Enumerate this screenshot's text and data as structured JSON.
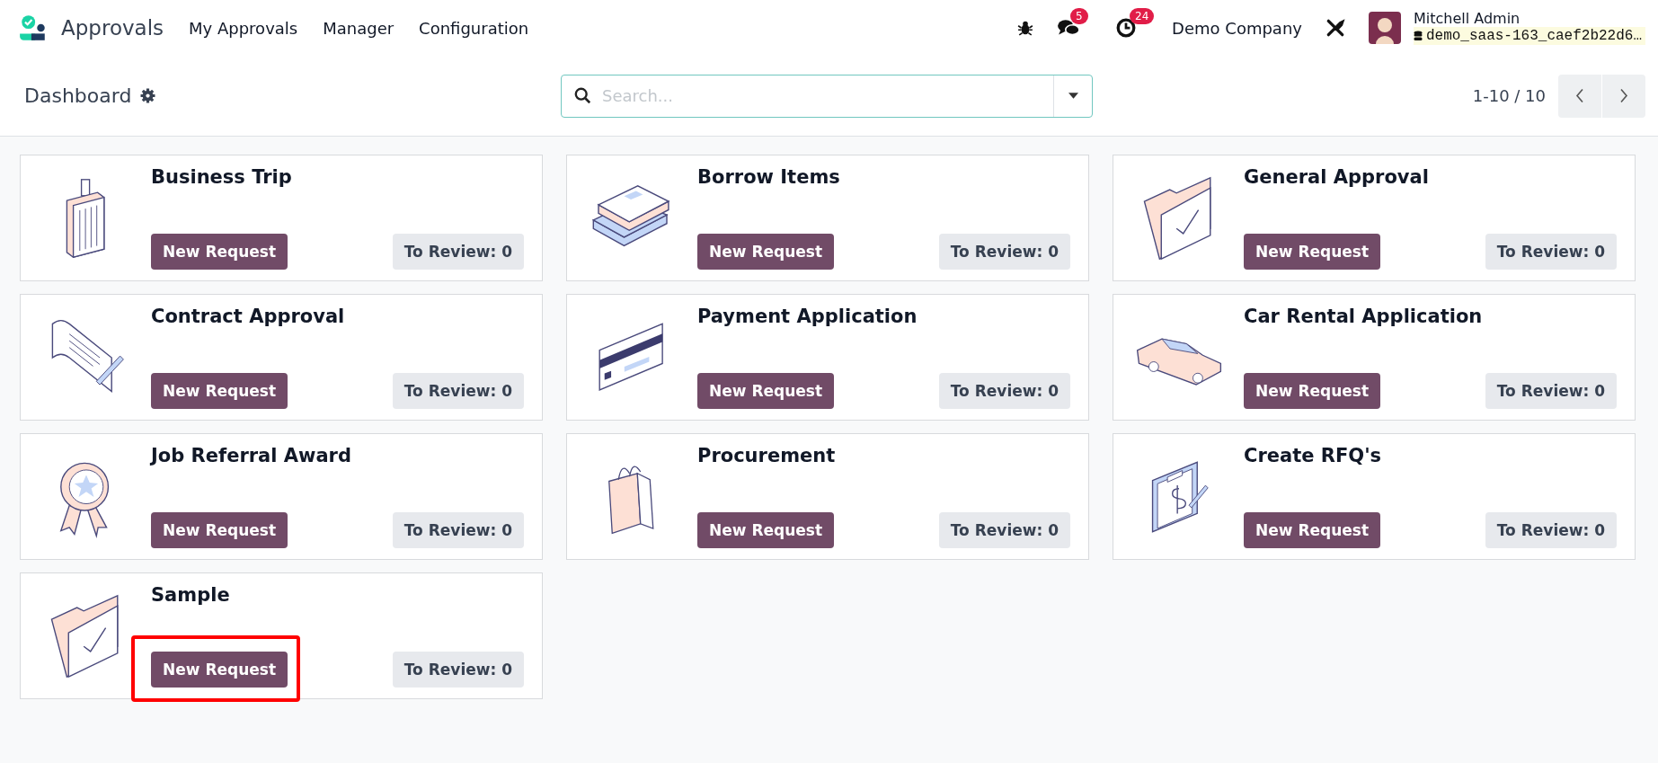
{
  "navbar": {
    "app_name": "Approvals",
    "menu": [
      {
        "label": "My Approvals"
      },
      {
        "label": "Manager"
      },
      {
        "label": "Configuration"
      }
    ],
    "messages_badge": "5",
    "activities_badge": "24",
    "company": "Demo Company",
    "user_name": "Mitchell Admin",
    "database": "demo_saas-163_caef2b22d6…"
  },
  "control_panel": {
    "title": "Dashboard",
    "search": {
      "placeholder": "Search..."
    },
    "pager": "1-10 / 10"
  },
  "cards": [
    {
      "title": "Business Trip",
      "button": "New Request",
      "review": "To Review: 0",
      "highlighted": false
    },
    {
      "title": "Borrow Items",
      "button": "New Request",
      "review": "To Review: 0",
      "highlighted": false
    },
    {
      "title": "General Approval",
      "button": "New Request",
      "review": "To Review: 0",
      "highlighted": false
    },
    {
      "title": "Contract Approval",
      "button": "New Request",
      "review": "To Review: 0",
      "highlighted": false
    },
    {
      "title": "Payment Application",
      "button": "New Request",
      "review": "To Review: 0",
      "highlighted": false
    },
    {
      "title": "Car Rental Application",
      "button": "New Request",
      "review": "To Review: 0",
      "highlighted": false
    },
    {
      "title": "Job Referral Award",
      "button": "New Request",
      "review": "To Review: 0",
      "highlighted": false
    },
    {
      "title": "Procurement",
      "button": "New Request",
      "review": "To Review: 0",
      "highlighted": false
    },
    {
      "title": "Create RFQ's",
      "button": "New Request",
      "review": "To Review: 0",
      "highlighted": false
    },
    {
      "title": "Sample",
      "button": "New Request",
      "review": "To Review: 0",
      "highlighted": true
    }
  ]
}
